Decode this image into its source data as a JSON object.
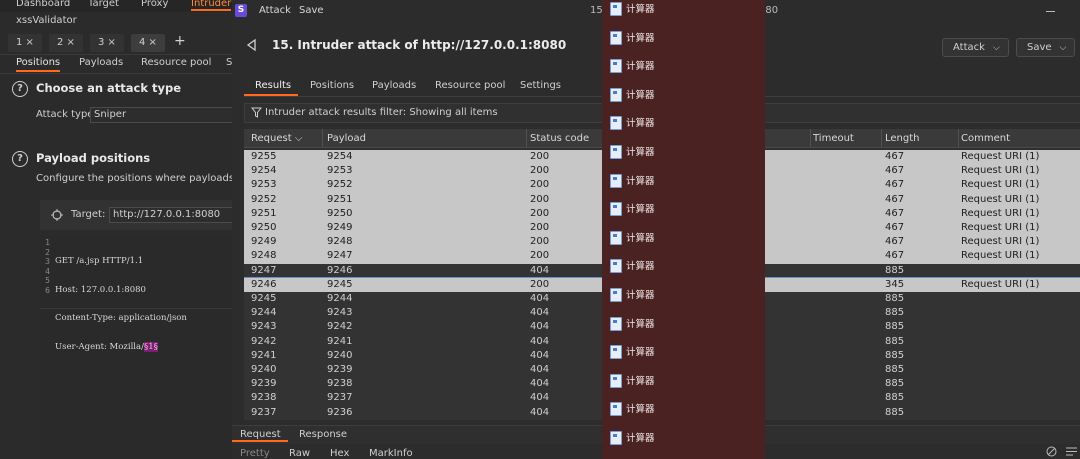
{
  "bg_window": {
    "nav": [
      "Dashboard",
      "Target",
      "Proxy",
      "Intruder"
    ],
    "subtitle": "xssValidator",
    "num_tabs": [
      "1 ×",
      "2 ×",
      "3 ×",
      "4 ×"
    ],
    "plus": "+",
    "sect_tabs": [
      "Positions",
      "Payloads",
      "Resource pool",
      "S"
    ],
    "choose_attack_title": "Choose an attack type",
    "attack_type_label": "Attack type:",
    "attack_type_value": "Sniper",
    "payload_positions_title": "Payload positions",
    "payload_positions_desc": "Configure the positions where payloads will b",
    "target_label": "Target:",
    "target_value": "http://127.0.0.1:8080",
    "line_numbers": [
      "1",
      "2",
      "3",
      "4",
      "5",
      "6"
    ],
    "code": {
      "l1": "GET /a.jsp HTTP/1.1",
      "l2": "Host: 127.0.0.1:8080",
      "l3": "Content-Type: application/json",
      "l4_prefix": "User-Agent: Mozilla/",
      "l4_marker": "§1§"
    }
  },
  "attack_window": {
    "menu": [
      "Attack",
      "Save"
    ],
    "title_ghost_left": "15.",
    "title_ghost_right": "080",
    "title": "15. Intruder attack of http://127.0.0.1:8080",
    "attack_btn": "Attack",
    "save_btn": "Save",
    "tabs": [
      "Results",
      "Positions",
      "Payloads",
      "Resource pool",
      "Settings"
    ],
    "filter_text": "Intruder attack results filter: Showing all items",
    "columns": [
      "Request",
      "Payload",
      "Status code",
      "Timeout",
      "Length",
      "Comment"
    ],
    "rows": [
      {
        "request": "9255",
        "payload": "9254",
        "status": "200",
        "length": "467",
        "comment": "Request URI (1)",
        "style": "hl"
      },
      {
        "request": "9254",
        "payload": "9253",
        "status": "200",
        "length": "467",
        "comment": "Request URI (1)",
        "style": "hl"
      },
      {
        "request": "9253",
        "payload": "9252",
        "status": "200",
        "length": "467",
        "comment": "Request URI (1)",
        "style": "hl"
      },
      {
        "request": "9252",
        "payload": "9251",
        "status": "200",
        "length": "467",
        "comment": "Request URI (1)",
        "style": "hl"
      },
      {
        "request": "9251",
        "payload": "9250",
        "status": "200",
        "length": "467",
        "comment": "Request URI (1)",
        "style": "hl"
      },
      {
        "request": "9250",
        "payload": "9249",
        "status": "200",
        "length": "467",
        "comment": "Request URI (1)",
        "style": "hl"
      },
      {
        "request": "9249",
        "payload": "9248",
        "status": "200",
        "length": "467",
        "comment": "Request URI (1)",
        "style": "hl"
      },
      {
        "request": "9248",
        "payload": "9247",
        "status": "200",
        "length": "467",
        "comment": "Request URI (1)",
        "style": "hl"
      },
      {
        "request": "9247",
        "payload": "9246",
        "status": "404",
        "length": "885",
        "comment": "",
        "style": "dark"
      },
      {
        "request": "9246",
        "payload": "9245",
        "status": "200",
        "length": "345",
        "comment": "Request URI (1)",
        "style": "sel"
      },
      {
        "request": "9245",
        "payload": "9244",
        "status": "404",
        "length": "885",
        "comment": "",
        "style": "dark"
      },
      {
        "request": "9244",
        "payload": "9243",
        "status": "404",
        "length": "885",
        "comment": "",
        "style": "dark"
      },
      {
        "request": "9243",
        "payload": "9242",
        "status": "404",
        "length": "885",
        "comment": "",
        "style": "dark"
      },
      {
        "request": "9242",
        "payload": "9241",
        "status": "404",
        "length": "885",
        "comment": "",
        "style": "dark"
      },
      {
        "request": "9241",
        "payload": "9240",
        "status": "404",
        "length": "885",
        "comment": "",
        "style": "dark"
      },
      {
        "request": "9240",
        "payload": "9239",
        "status": "404",
        "length": "885",
        "comment": "",
        "style": "dark"
      },
      {
        "request": "9239",
        "payload": "9238",
        "status": "404",
        "length": "885",
        "comment": "",
        "style": "dark"
      },
      {
        "request": "9238",
        "payload": "9237",
        "status": "404",
        "length": "885",
        "comment": "",
        "style": "dark"
      },
      {
        "request": "9237",
        "payload": "9236",
        "status": "404",
        "length": "885",
        "comment": "",
        "style": "dark"
      }
    ],
    "bottom_tabs": [
      "Request",
      "Response"
    ],
    "view_tabs": [
      "Pretty",
      "Raw",
      "Hex",
      "MarkInfo"
    ]
  },
  "overlay": {
    "items": [
      "计算器",
      "计算器",
      "计算器",
      "计算器",
      "计算器",
      "计算器",
      "计算器",
      "计算器",
      "计算器",
      "计算器",
      "计算器",
      "计算器",
      "计算器",
      "计算器",
      "计算器",
      "计算器"
    ]
  },
  "colors": {
    "accent": "#ff6a1a",
    "overlay_bg": "#4a2222",
    "highlight_row": "#c7c7c7"
  }
}
